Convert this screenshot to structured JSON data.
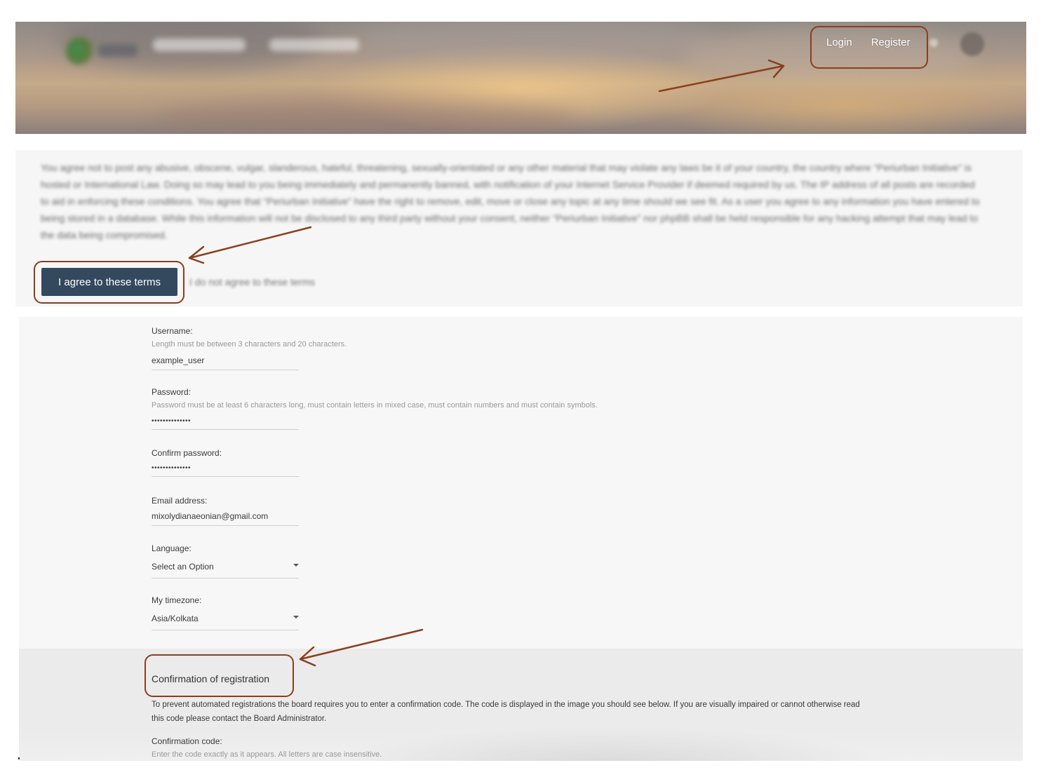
{
  "header": {
    "auth": {
      "login": "Login",
      "register": "Register"
    }
  },
  "terms": {
    "text": "You agree not to post any abusive, obscene, vulgar, slanderous, hateful, threatening, sexually-orientated or any other material that may violate any laws be it of your country, the country where “Periurban Initiative” is hosted or International Law. Doing so may lead to you being immediately and permanently banned, with notification of your Internet Service Provider if deemed required by us. The IP address of all posts are recorded to aid in enforcing these conditions. You agree that “Periurban Initiative” have the right to remove, edit, move or close any topic at any time should we see fit. As a user you agree to any information you have entered to being stored in a database. While this information will not be disclosed to any third party without your consent, neither “Periurban Initiative” nor phpBB shall be held responsible for any hacking attempt that may lead to the data being compromised.",
    "agree_button": "I agree to these terms",
    "disagree_link": "I do not agree to these terms"
  },
  "form": {
    "username": {
      "label": "Username:",
      "hint": "Length must be between 3 characters and 20 characters.",
      "value": "example_user"
    },
    "password": {
      "label": "Password:",
      "hint": "Password must be at least 6 characters long, must contain letters in mixed case, must contain numbers and must contain symbols.",
      "value": "••••••••••••••"
    },
    "confirm_password": {
      "label": "Confirm password:",
      "value": "••••••••••••••"
    },
    "email": {
      "label": "Email address:",
      "value": "mixolydianaeonian@gmail.com"
    },
    "language": {
      "label": "Language:",
      "value": "Select an Option"
    },
    "timezone": {
      "label": "My timezone:",
      "value": "Asia/Kolkata"
    }
  },
  "confirmation": {
    "title": "Confirmation of registration",
    "description": "To prevent automated registrations the board requires you to enter a confirmation code. The code is displayed in the image you should see below. If you are visually impaired or cannot otherwise read this code please contact the Board Administrator.",
    "code_label": "Confirmation code:",
    "code_hint": "Enter the code exactly as it appears. All letters are case insensitive."
  },
  "annotation_color": "#8b3e1c"
}
